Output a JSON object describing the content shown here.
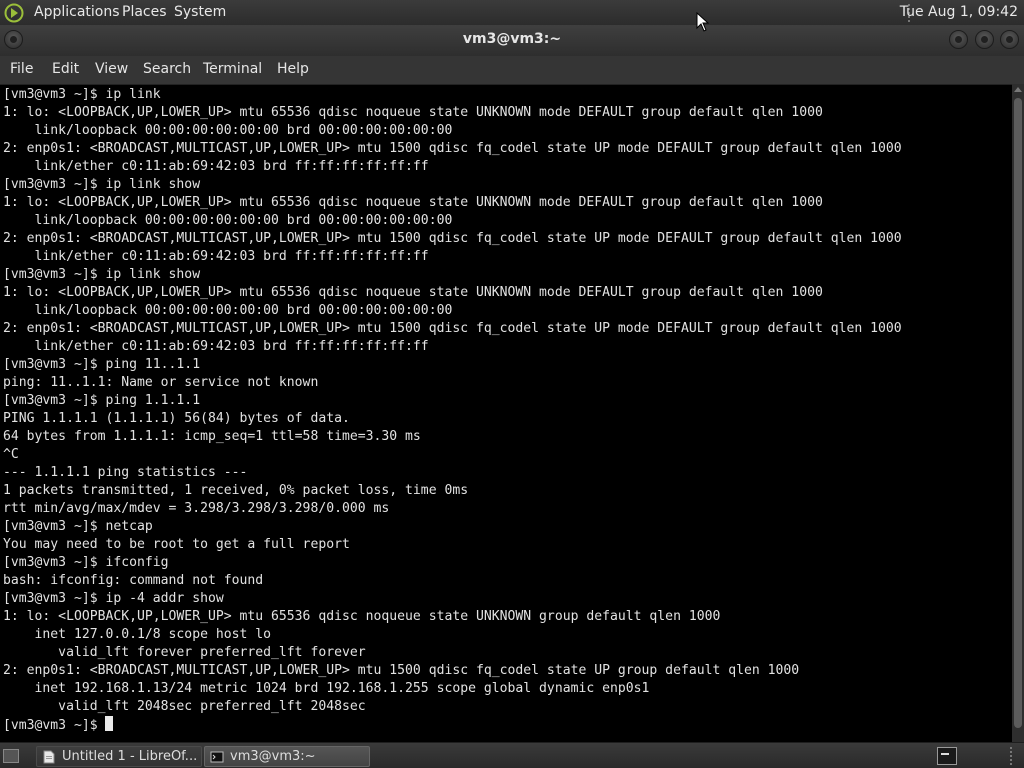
{
  "top_panel": {
    "menus": [
      "Applications",
      "Places",
      "System"
    ],
    "clock": "Tue Aug  1, 09:42"
  },
  "window": {
    "title": "vm3@vm3:~"
  },
  "menubar": {
    "items": [
      "File",
      "Edit",
      "View",
      "Search",
      "Terminal",
      "Help"
    ]
  },
  "terminal": {
    "lines": [
      "[vm3@vm3 ~]$ ip link",
      "1: lo: <LOOPBACK,UP,LOWER_UP> mtu 65536 qdisc noqueue state UNKNOWN mode DEFAULT group default qlen 1000",
      "    link/loopback 00:00:00:00:00:00 brd 00:00:00:00:00:00",
      "2: enp0s1: <BROADCAST,MULTICAST,UP,LOWER_UP> mtu 1500 qdisc fq_codel state UP mode DEFAULT group default qlen 1000",
      "    link/ether c0:11:ab:69:42:03 brd ff:ff:ff:ff:ff:ff",
      "[vm3@vm3 ~]$ ip link show",
      "1: lo: <LOOPBACK,UP,LOWER_UP> mtu 65536 qdisc noqueue state UNKNOWN mode DEFAULT group default qlen 1000",
      "    link/loopback 00:00:00:00:00:00 brd 00:00:00:00:00:00",
      "2: enp0s1: <BROADCAST,MULTICAST,UP,LOWER_UP> mtu 1500 qdisc fq_codel state UP mode DEFAULT group default qlen 1000",
      "    link/ether c0:11:ab:69:42:03 brd ff:ff:ff:ff:ff:ff",
      "[vm3@vm3 ~]$ ip link show",
      "1: lo: <LOOPBACK,UP,LOWER_UP> mtu 65536 qdisc noqueue state UNKNOWN mode DEFAULT group default qlen 1000",
      "    link/loopback 00:00:00:00:00:00 brd 00:00:00:00:00:00",
      "2: enp0s1: <BROADCAST,MULTICAST,UP,LOWER_UP> mtu 1500 qdisc fq_codel state UP mode DEFAULT group default qlen 1000",
      "    link/ether c0:11:ab:69:42:03 brd ff:ff:ff:ff:ff:ff",
      "[vm3@vm3 ~]$ ping 11..1.1",
      "ping: 11..1.1: Name or service not known",
      "[vm3@vm3 ~]$ ping 1.1.1.1",
      "PING 1.1.1.1 (1.1.1.1) 56(84) bytes of data.",
      "64 bytes from 1.1.1.1: icmp_seq=1 ttl=58 time=3.30 ms",
      "^C",
      "--- 1.1.1.1 ping statistics ---",
      "1 packets transmitted, 1 received, 0% packet loss, time 0ms",
      "rtt min/avg/max/mdev = 3.298/3.298/3.298/0.000 ms",
      "[vm3@vm3 ~]$ netcap",
      "You may need to be root to get a full report",
      "[vm3@vm3 ~]$ ifconfig",
      "bash: ifconfig: command not found",
      "[vm3@vm3 ~]$ ip -4 addr show",
      "1: lo: <LOOPBACK,UP,LOWER_UP> mtu 65536 qdisc noqueue state UNKNOWN group default qlen 1000",
      "    inet 127.0.0.1/8 scope host lo",
      "       valid_lft forever preferred_lft forever",
      "2: enp0s1: <BROADCAST,MULTICAST,UP,LOWER_UP> mtu 1500 qdisc fq_codel state UP group default qlen 1000",
      "    inet 192.168.1.13/24 metric 1024 brd 192.168.1.255 scope global dynamic enp0s1",
      "       valid_lft 2048sec preferred_lft 2048sec"
    ],
    "prompt": "[vm3@vm3 ~]$ "
  },
  "taskbar": {
    "tasks": [
      {
        "label": "Untitled 1 - LibreOf...",
        "icon": "libreoffice-document-icon"
      },
      {
        "label": "vm3@vm3:~",
        "icon": "terminal-icon"
      }
    ]
  }
}
